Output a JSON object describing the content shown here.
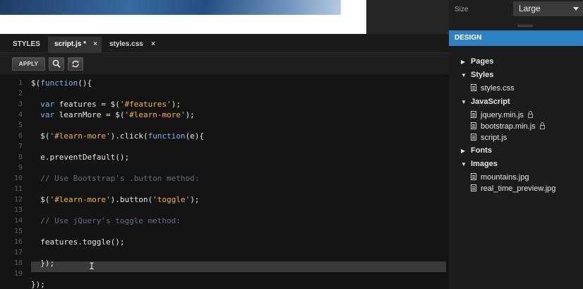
{
  "editor": {
    "tabs": [
      {
        "label": "STYLES",
        "close": ""
      },
      {
        "label": "script.js *",
        "close": "×"
      },
      {
        "label": "styles.css",
        "close": "×"
      }
    ],
    "toolbar": {
      "apply_label": "APPLY",
      "search_icon": "search-icon",
      "replace_icon": "refresh-icon"
    },
    "line_numbers": [
      "1",
      "2",
      "3",
      "4",
      "5",
      "6",
      "7",
      "8",
      "9",
      "10",
      "11",
      "12",
      "13",
      "14",
      "15",
      "16",
      "17",
      "18",
      "19"
    ],
    "code": [
      "$(function(){",
      "",
      "  var features = $('#features');",
      "  var learnMore = $('#learn-more');",
      "",
      "  $('#learn-more').click(function(e){",
      "",
      "  e.preventDefault();",
      "",
      "  // Use Bootstrap's .button method:",
      "",
      "  $('#learn-more').button('toggle');",
      "",
      "  // Use jQuery's toggle method:",
      "",
      "  features.toggle();",
      "",
      "  });",
      "",
      "});"
    ]
  },
  "side_panel": {
    "size_label": "Size",
    "size_value": "Large",
    "design_header": "DESIGN",
    "tree": {
      "pages": "Pages",
      "styles": "Styles",
      "styles_css": "styles.css",
      "javascript": "JavaScript",
      "jquery": "jquery.min.js",
      "bootstrap": "bootstrap.min.js",
      "script": "script.js",
      "fonts": "Fonts",
      "images": "Images",
      "mountains": "mountains.jpg",
      "realtime": "real_time_preview.jpg"
    }
  },
  "colors": {
    "accent": "#2e82c3",
    "string": "#f4b253",
    "comment": "#5e6f80",
    "keyword": "#7db3ea"
  }
}
